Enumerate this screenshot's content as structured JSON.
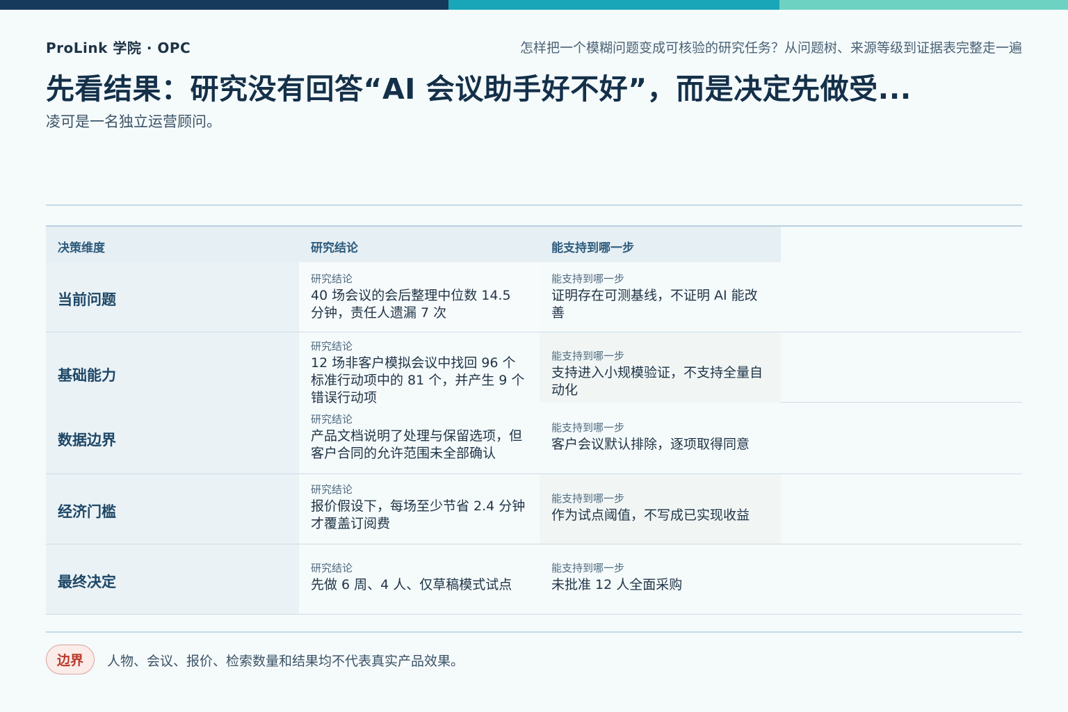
{
  "header": {
    "brand": "ProLink 学院 · OPC",
    "subtitle": "怎样把一个模糊问题变成可核验的研究任务？从问题树、来源等级到证据表完整走一遍",
    "title": "先看结果：研究没有回答“AI 会议助手好不好”，而是决定先做受...",
    "lead": "凌可是一名独立运营顾问。"
  },
  "table": {
    "headers": [
      "决策维度",
      "研究结论",
      "能支持到哪一步"
    ],
    "rows": [
      {
        "dimension": "当前问题",
        "finding_label": "研究结论",
        "finding": "40 场会议的会后整理中位数 14.5 分钟，责任人遗漏 7 次",
        "support_label": "能支持到哪一步",
        "support": "证明存在可测基线，不证明 AI 能改善"
      },
      {
        "dimension": "基础能力",
        "finding_label": "研究结论",
        "finding": "12 场非客户模拟会议中找回 96 个标准行动项中的 81 个，并产生 9 个错误行动项",
        "support_label": "能支持到哪一步",
        "support": "支持进入小规模验证，不支持全量自动化"
      },
      {
        "dimension": "数据边界",
        "finding_label": "研究结论",
        "finding": "产品文档说明了处理与保留选项，但客户合同的允许范围未全部确认",
        "support_label": "能支持到哪一步",
        "support": "客户会议默认排除，逐项取得同意"
      },
      {
        "dimension": "经济门槛",
        "finding_label": "研究结论",
        "finding": "报价假设下，每场至少节省 2.4 分钟才覆盖订阅费",
        "support_label": "能支持到哪一步",
        "support": "作为试点阈值，不写成已实现收益"
      },
      {
        "dimension": "最终决定",
        "finding_label": "研究结论",
        "finding": "先做 6 周、4 人、仅草稿模式试点",
        "support_label": "能支持到哪一步",
        "support": "未批准 12 人全面采购"
      }
    ]
  },
  "footer": {
    "badge": "边界",
    "note": "人物、会议、报价、检索数量和结果均不代表真实产品效果。"
  }
}
